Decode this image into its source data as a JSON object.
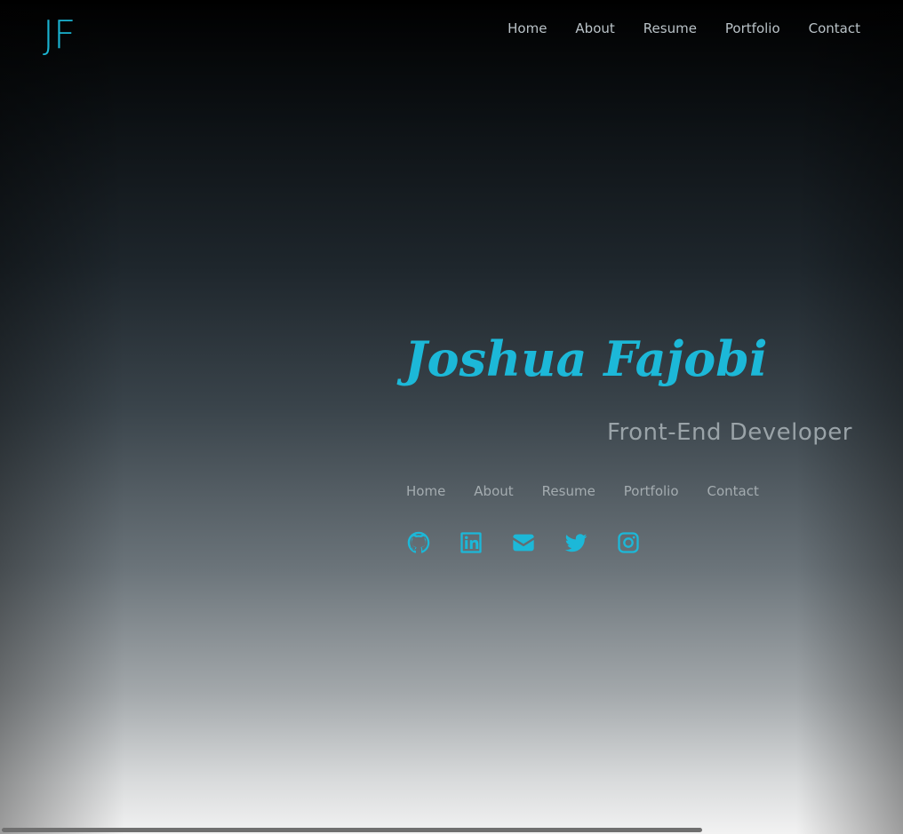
{
  "header": {
    "logo": "JF",
    "nav": [
      "Home",
      "About",
      "Resume",
      "Portfolio",
      "Contact"
    ]
  },
  "hero": {
    "name": "Joshua Fajobi",
    "role": "Front-End Developer",
    "nav": [
      "Home",
      "About",
      "Resume",
      "Portfolio",
      "Contact"
    ],
    "socials": [
      "github-icon",
      "linkedin-icon",
      "envelope-icon",
      "twitter-icon",
      "instagram-icon"
    ]
  },
  "colors": {
    "accent": "#1cb8d8",
    "nav_text": "#b9c2c7"
  },
  "scrollbar": {
    "horizontal_position": 0
  }
}
